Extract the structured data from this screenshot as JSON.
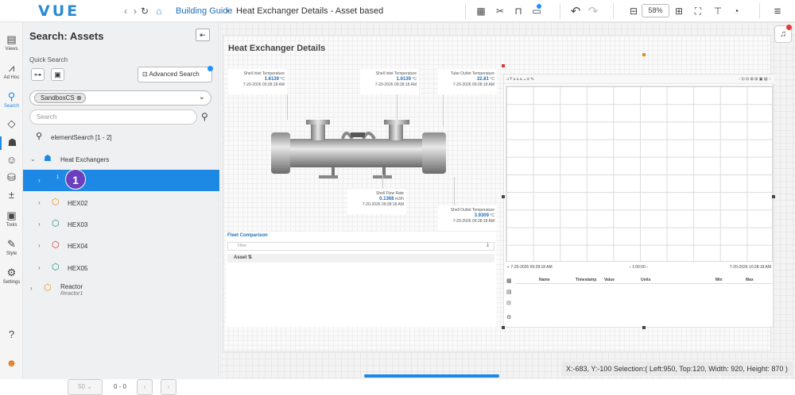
{
  "app": {
    "logo": "VUE"
  },
  "breadcrumb": {
    "home_icon": "home-icon",
    "item1": "Building Guide",
    "item2": "Heat Exchanger Details - Asset based"
  },
  "toolbar": {
    "zoom": "58%"
  },
  "rail": {
    "items": [
      {
        "label": "Views",
        "icon": "views-icon"
      },
      {
        "label": "Ad Hoc",
        "icon": "adhoc-icon"
      },
      {
        "label": "Search",
        "icon": "search-icon"
      },
      {
        "label": "Tools",
        "icon": "tools-icon"
      },
      {
        "label": "Style",
        "icon": "style-icon"
      },
      {
        "label": "Settings",
        "icon": "settings-icon"
      }
    ]
  },
  "panel": {
    "title": "Search: Assets",
    "quick_search_label": "Quick Search",
    "advanced_search": "Advanced Search",
    "filter_chip": "SandboxCS",
    "search_placeholder": "Search",
    "element_search": "elementSearch [1 - 2]",
    "tree": {
      "group": "Heat Exchangers",
      "selected_label": "1",
      "items": [
        "HEX02",
        "HEX03",
        "HEX04",
        "HEX05"
      ],
      "reactor": "Reactor",
      "reactor_sub": "Reactor1"
    },
    "badge": "1",
    "pager": {
      "size": "50",
      "range": "0 - 0"
    }
  },
  "canvas": {
    "title": "Heat Exchanger Details",
    "sensors": [
      {
        "name": "Shell Inlet Temperature",
        "value": "1.6139",
        "unit": "°C",
        "time": "7-20-2026 09:28:18 AM"
      },
      {
        "name": "Shell Inlet Temperature",
        "value": "1.6139",
        "unit": "°C",
        "time": "7-20-2026 09:28:18 AM"
      },
      {
        "name": "Tube Outlet Temperature",
        "value": "22.81",
        "unit": "°C",
        "time": "7-20-2026 09:28:18 AM"
      },
      {
        "name": "Shell Flow Rate",
        "value": "0.1368",
        "unit": "m3/h",
        "time": "7-20-2026 09:28:18 AM"
      },
      {
        "name": "Shell Outlet Temperature",
        "value": "3.9309",
        "unit": "°C",
        "time": "7-20-2026 09:28:18 AM"
      }
    ],
    "fleet": {
      "title": "Fleet Comparison",
      "filter_placeholder": "Filter",
      "col": "Asset"
    },
    "trend": {
      "start": "7-20-2026 09:28:18 AM",
      "span": "1:00:00",
      "end": "7-20-2026 10:28:18 AM",
      "columns": [
        "Name",
        "Timestamp",
        "Value",
        "Units",
        "Min",
        "Max"
      ]
    }
  },
  "status": "X:-683, Y:-100  Selection:( Left:950, Top:120, Width: 920, Height: 870 )"
}
